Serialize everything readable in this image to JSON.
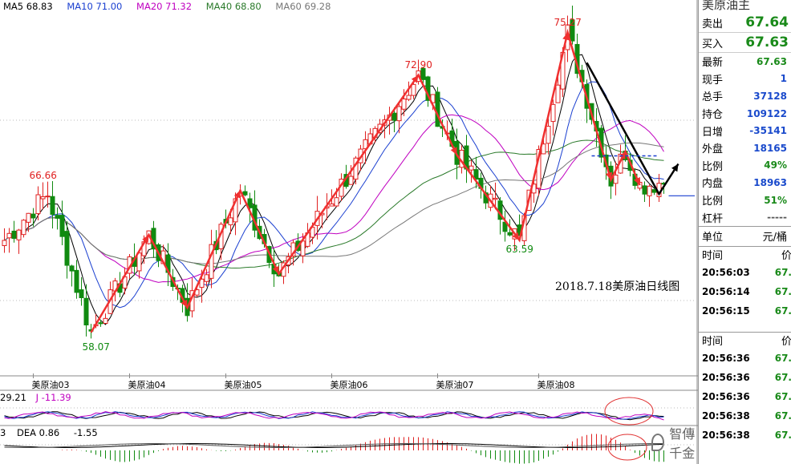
{
  "chart_data": {
    "type": "candlestick",
    "title": "2018.7.18美原油日线图",
    "legend": [
      {
        "name": "MA5",
        "value": "68.83",
        "color": "#000000"
      },
      {
        "name": "MA10",
        "value": "71.00",
        "color": "#1a3fd0"
      },
      {
        "name": "MA20",
        "value": "71.32",
        "color": "#c000c0"
      },
      {
        "name": "MA40",
        "value": "68.80",
        "color": "#2a7a2a"
      },
      {
        "name": "MA60",
        "value": "69.28",
        "color": "#777777"
      }
    ],
    "x_ticks": [
      "美原油03",
      "美原油04",
      "美原油05",
      "美原油06",
      "美原油07",
      "美原油08"
    ],
    "y_range": [
      56.0,
      76.5
    ],
    "peaks": [
      {
        "label": "66.66",
        "value": 66.66,
        "index": 8,
        "kind": "high"
      },
      {
        "label": "58.07",
        "value": 58.07,
        "index": 19,
        "kind": "low"
      },
      {
        "label": "72.90",
        "value": 72.9,
        "index": 86,
        "kind": "high"
      },
      {
        "label": "63.59",
        "value": 63.59,
        "index": 107,
        "kind": "low"
      },
      {
        "label": "75.27",
        "value": 75.27,
        "index": 117,
        "kind": "high"
      }
    ],
    "wave_path": [
      [
        18,
        58.4
      ],
      [
        30,
        63.9
      ],
      [
        38,
        59.8
      ],
      [
        49,
        66.4
      ],
      [
        57,
        61.7
      ],
      [
        86,
        72.9
      ],
      [
        94,
        68.4
      ],
      [
        107,
        63.6
      ],
      [
        117,
        75.3
      ],
      [
        126,
        67.0
      ],
      [
        129,
        68.6
      ],
      [
        132,
        66.7
      ]
    ],
    "trend_arrow": [
      [
        121,
        73.6
      ],
      [
        136,
        66.2
      ],
      [
        140,
        67.9
      ]
    ],
    "reference_line": {
      "value": 68.35,
      "from_index": 122,
      "to_index": 136
    },
    "kdj_legend": {
      "left": "29.21",
      "j": "J -11.39"
    },
    "macd_legend": {
      "left": "3",
      "dea": "DEA 0.86",
      "macd": "-1.55"
    }
  },
  "side_panel": {
    "title": "美原油主",
    "sell_label": "卖出",
    "sell_value": "67.64",
    "buy_label": "买入",
    "buy_value": "67.63",
    "stats": [
      {
        "label": "最新",
        "value": "67.63",
        "color": "green"
      },
      {
        "label": "现手",
        "value": "1",
        "color": "blue"
      },
      {
        "label": "总手",
        "value": "37128",
        "color": "blue"
      },
      {
        "label": "持仓",
        "value": "109122",
        "color": "blue"
      },
      {
        "label": "日增",
        "value": "-35141",
        "color": "blue"
      },
      {
        "label": "外盘",
        "value": "18165",
        "color": "blue"
      },
      {
        "label": "比例",
        "value": "49%",
        "color": "green"
      },
      {
        "label": "内盘",
        "value": "18963",
        "color": "blue"
      },
      {
        "label": "比例",
        "value": "51%",
        "color": "green"
      },
      {
        "label": "杠杆",
        "value": "-----",
        "color": "gray"
      }
    ],
    "unit_label": "单位",
    "unit_value": "元/桶",
    "time_header": "时间",
    "price_header": "价",
    "trades1": [
      {
        "time": "20:56:03",
        "price": "67."
      },
      {
        "time": "20:56:14",
        "price": "67."
      },
      {
        "time": "20:56:15",
        "price": "67."
      }
    ],
    "trades2": [
      {
        "time": "20:56:36",
        "price": "67."
      },
      {
        "time": "20:56:36",
        "price": "67."
      },
      {
        "time": "20:56:36",
        "price": "67."
      },
      {
        "time": "20:56:38",
        "price": "67."
      },
      {
        "time": "20:56:38",
        "price": "67."
      }
    ]
  },
  "watermark": "智傳千金"
}
